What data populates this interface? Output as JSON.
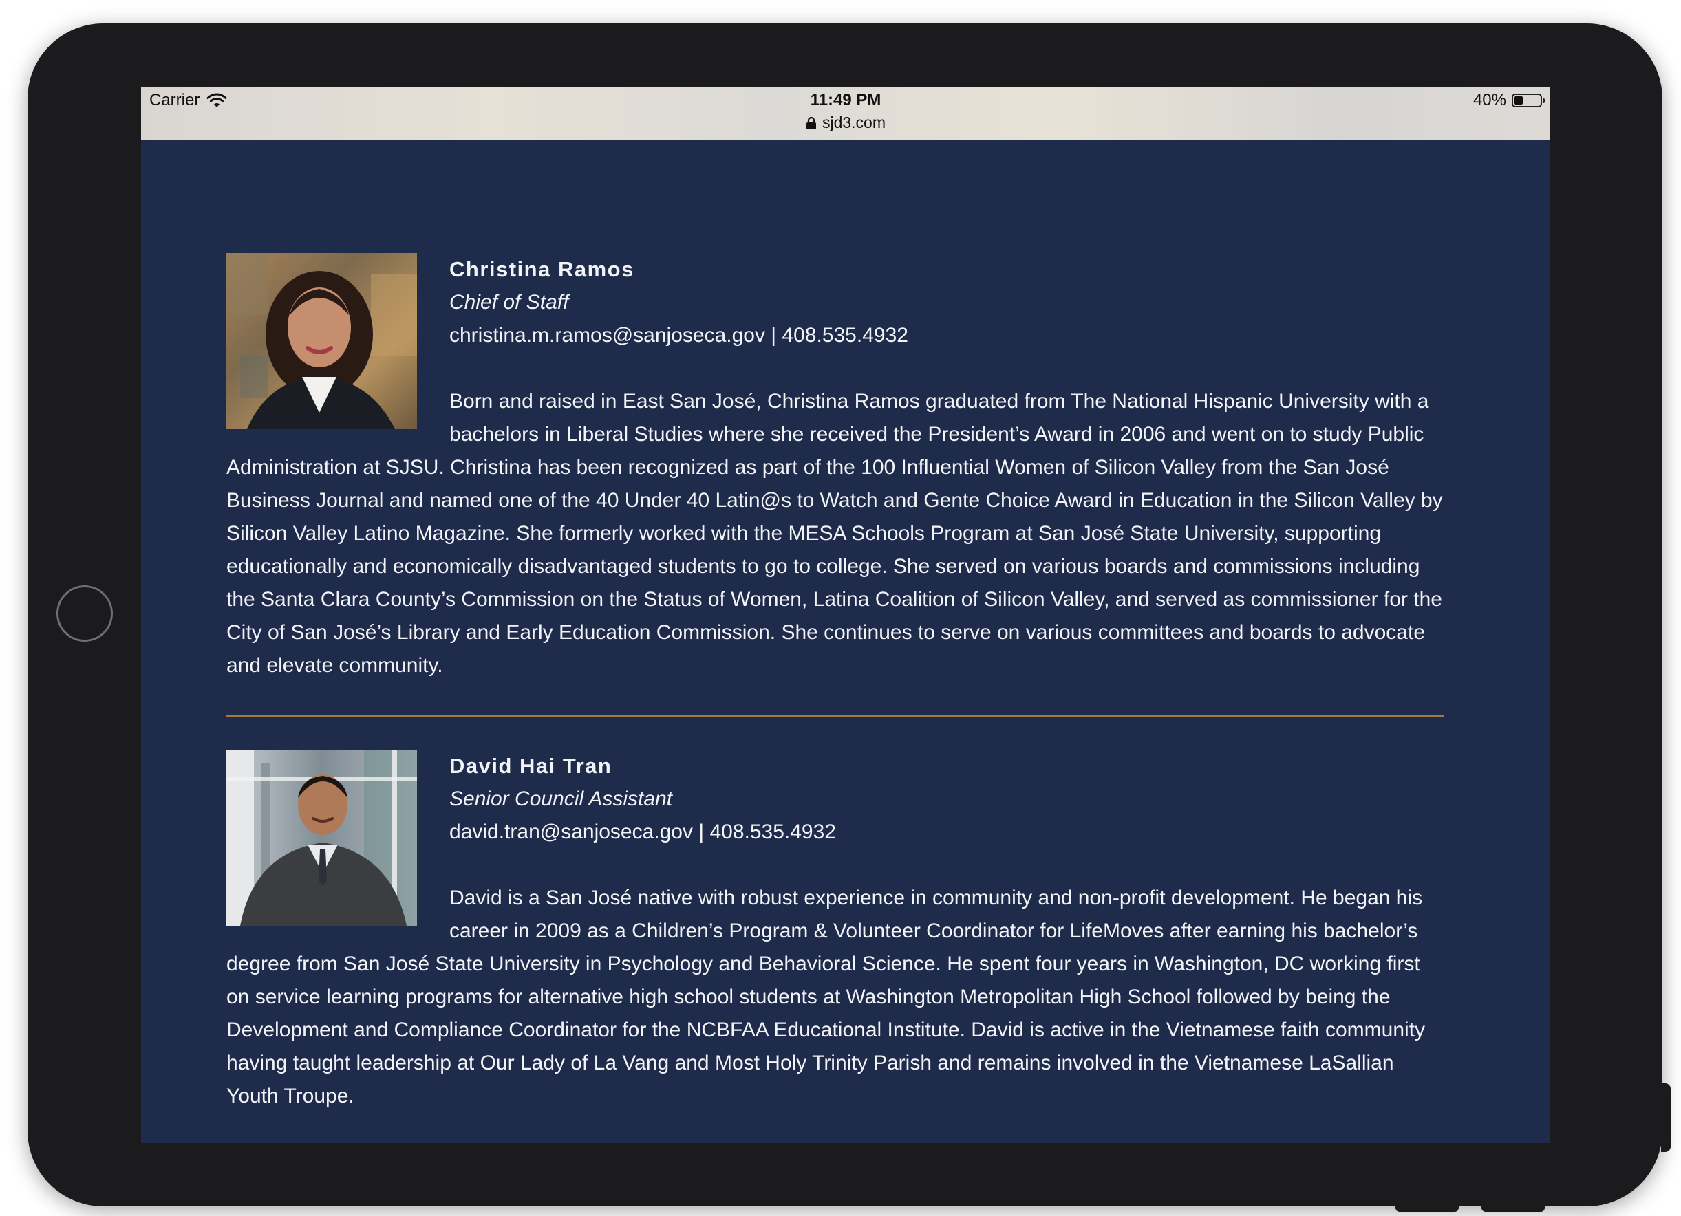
{
  "status_bar": {
    "carrier": "Carrier",
    "time": "11:49 PM",
    "url": "sjd3.com",
    "battery_label": "40%",
    "battery_level": 0.4
  },
  "staff": [
    {
      "name": "Christina Ramos",
      "role": "Chief of Staff",
      "contact": "christina.m.ramos@sanjoseca.gov | 408.535.4932",
      "bio": "Born and raised in East San José, Christina Ramos graduated from The National Hispanic University with a bachelors in Liberal Studies where she received the President’s Award in 2006 and went on to study Public Administration at SJSU. Christina has been recognized as part of the 100 Influential Women of Silicon Valley from the San José Business Journal and named one of the 40 Under 40 Latin@s to Watch and Gente Choice Award in Education in the Silicon Valley by Silicon Valley Latino Magazine. She formerly worked with the MESA Schools Program at San José State University, supporting educationally and economically disadvantaged students to go to college. She served on various boards and commissions including the Santa Clara County’s Commission on the Status of Women, Latina Coalition of Silicon Valley, and served as commissioner for the City of San José’s Library and Early Education Commission. She continues to serve on various committees and boards to advocate and elevate community."
    },
    {
      "name": "David Hai Tran",
      "role": "Senior Council Assistant",
      "contact": "david.tran@sanjoseca.gov | 408.535.4932",
      "bio": "David is a San José native with robust experience in community and non-profit development. He began his career in 2009 as a Children’s Program & Volunteer Coordinator for LifeMoves after earning his bachelor’s degree from San José State University in Psychology and Behavioral Science.  He spent four years in Washington, DC working first on service learning programs for alternative high school students at Washington Metropolitan High School followed by being the Development and Compliance Coordinator for the NCBFAA Educational Institute.  David is active in the Vietnamese faith community having taught leadership at Our Lady of La Vang and Most Holy Trinity Parish and remains involved in the Vietnamese LaSallian Youth Troupe."
    }
  ],
  "colors": {
    "page_background": "#1e2b4b",
    "divider": "#a07a3f",
    "text": "#f2f3f6"
  }
}
